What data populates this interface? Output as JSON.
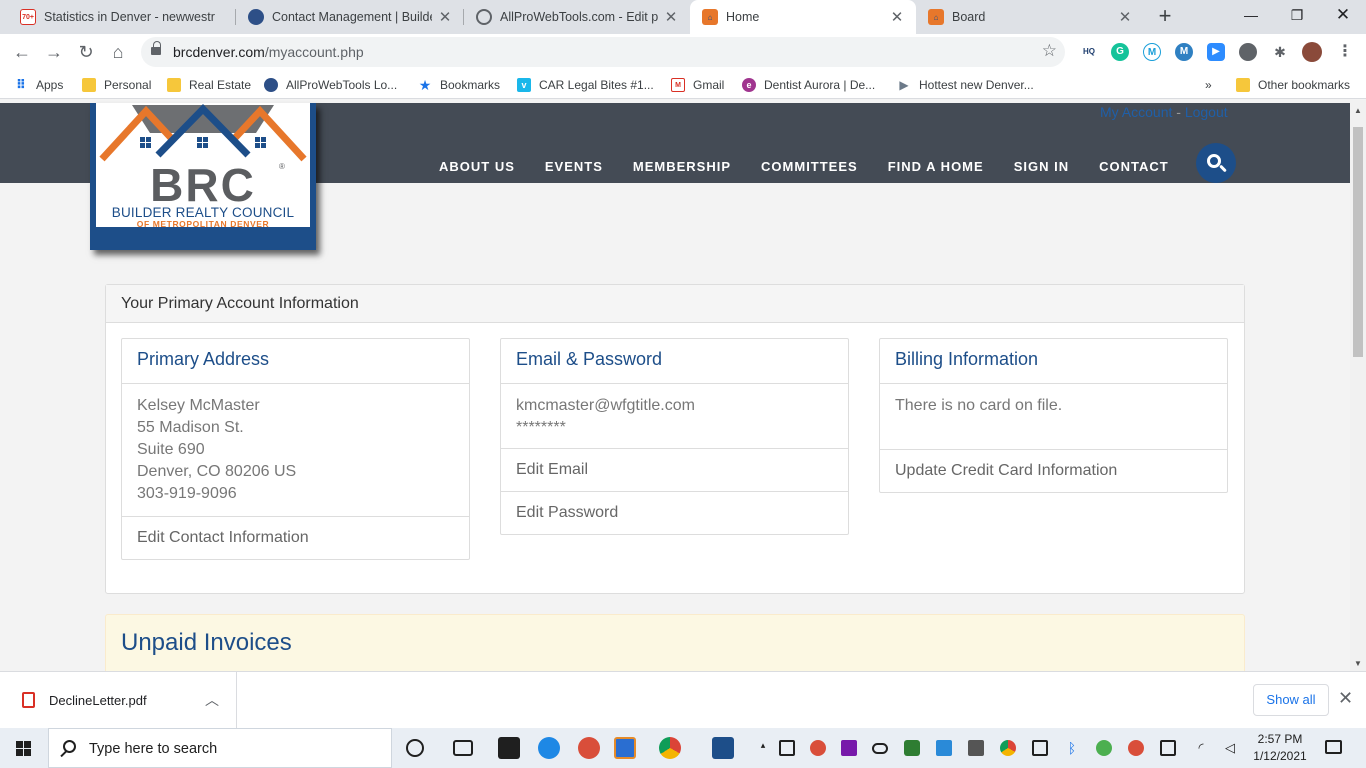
{
  "browser": {
    "tabs": [
      {
        "label": "Statistics in Denver - newwestr",
        "icon": "gmail-icon",
        "active": false
      },
      {
        "label": "Contact Management | Builder",
        "icon": "globe-icon",
        "active": false
      },
      {
        "label": "AllProWebTools.com - Edit pos",
        "icon": "globe-icon",
        "active": false
      },
      {
        "label": "Home",
        "icon": "brc-favicon",
        "active": true
      },
      {
        "label": "Board",
        "icon": "brc-favicon",
        "active": false
      }
    ],
    "gmail_badge": "70+",
    "url_domain": "brcdenver.com",
    "url_path": "/myaccount.php",
    "bookmarks": [
      {
        "label": "Apps",
        "icon": "apps-grid-icon"
      },
      {
        "label": "Personal",
        "icon": "folder-icon"
      },
      {
        "label": "Real Estate",
        "icon": "folder-icon"
      },
      {
        "label": "AllProWebTools Lo...",
        "icon": "globe-icon"
      },
      {
        "label": "Bookmarks",
        "icon": "star-icon"
      },
      {
        "label": "CAR Legal Bites #1...",
        "icon": "vimeo-icon"
      },
      {
        "label": "Gmail",
        "icon": "gmail-icon"
      },
      {
        "label": "Dentist Aurora | De...",
        "icon": "dentist-icon"
      },
      {
        "label": "Hottest new Denver...",
        "icon": "arrow-icon"
      }
    ],
    "other_bookmarks": "Other bookmarks",
    "overflow": "»"
  },
  "site": {
    "account_link": "My Account",
    "separator": "-",
    "logout_link": "Logout",
    "nav": [
      "ABOUT US",
      "EVENTS",
      "MEMBERSHIP",
      "COMMITTEES",
      "FIND A HOME",
      "SIGN IN",
      "CONTACT"
    ],
    "logo": {
      "letters": "BRC",
      "registered": "®",
      "line1": "BUILDER REALTY COUNCIL",
      "line2": "OF METROPOLITAN DENVER"
    }
  },
  "account": {
    "panel_title": "Your Primary Account Information",
    "primary_address": {
      "title": "Primary Address",
      "lines": [
        "Kelsey McMaster",
        "55 Madison St.",
        "Suite 690",
        "Denver, CO 80206 US",
        "303-919-9096"
      ],
      "action": "Edit Contact Information"
    },
    "email_password": {
      "title": "Email & Password",
      "email": "kmcmaster@wfgtitle.com",
      "password_mask": "********",
      "actions": [
        "Edit Email",
        "Edit Password"
      ]
    },
    "billing": {
      "title": "Billing Information",
      "message": "There is no card on file.",
      "action": "Update Credit Card Information"
    }
  },
  "invoices": {
    "title": "Unpaid Invoices"
  },
  "downloads": {
    "file_name": "DeclineLetter.pdf",
    "show_all": "Show all"
  },
  "taskbar": {
    "search_placeholder": "Type here to search",
    "time": "2:57 PM",
    "date": "1/12/2021"
  },
  "colors": {
    "brand_blue": "#1d4e89",
    "brand_orange": "#e7772b",
    "header_gray": "#444b55"
  }
}
